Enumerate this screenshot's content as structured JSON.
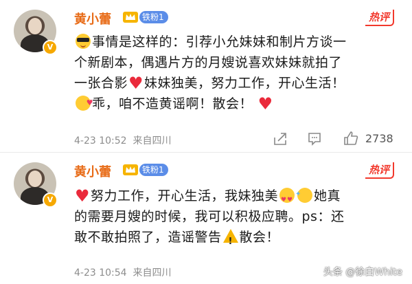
{
  "comments": [
    {
      "author": "黄小蕾",
      "fan_badge": "铁粉1",
      "hot_tag": "热评",
      "lines": [
        "事情是这样的：引荐小允妹妹和制片方谈一",
        "个新剧本，偶遇片方的月嫂说喜欢妹妹就拍了",
        "一张合影",
        "妹妹独美，努力工作，开心生活！",
        "乖，咱不造黄谣啊！散会！"
      ],
      "timestamp": "4-23 10:52",
      "location": "来自四川",
      "like_count": "2738"
    },
    {
      "author": "黄小蕾",
      "fan_badge": "铁粉1",
      "hot_tag": "热评",
      "lines": [
        "努力工作，开心生活，我妹独美",
        "她真",
        "的需要月嫂的时候，我可以积极应聘。ps：还",
        "敢不敢拍照了，造谣警告",
        "散会！"
      ],
      "timestamp": "4-23 10:54",
      "location": "来自四川"
    }
  ],
  "watermark": "头条 @徐白White",
  "icons": {
    "verified": "v-badge-icon",
    "crown": "crown-icon",
    "share": "share-icon",
    "comment": "comment-icon",
    "like": "thumbs-up-icon"
  },
  "colors": {
    "author": "#e86c18",
    "hot": "#f2382c",
    "badge": "#5b8de8",
    "meta": "#8c8c8c"
  }
}
